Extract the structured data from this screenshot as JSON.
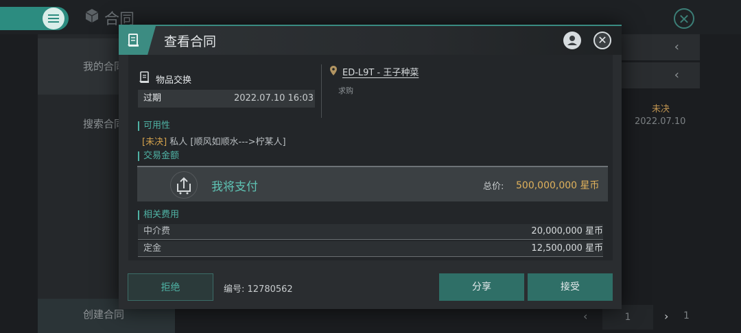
{
  "background": {
    "title": "合同",
    "sidebar": {
      "items": [
        "我的合同",
        "搜索合同"
      ],
      "bottom": "创建合同"
    },
    "list_status": "未决",
    "list_date": "2022.07.10",
    "pager": {
      "current": "1",
      "total": "1"
    }
  },
  "modal": {
    "title": "查看合同",
    "trade_type": "物品交换",
    "expire": {
      "label": "过期",
      "date": "2022.07.10 16:03"
    },
    "location": "ED-L9T - 王子种菜",
    "request": "求购",
    "availability": {
      "section": "可用性",
      "status": "[未决]",
      "text": "私人 [顺风如顺水--->柠某人]"
    },
    "amount": {
      "section": "交易金额",
      "pay_label": "我将支付",
      "total_label": "总价:",
      "total_value": "500,000,000 星币"
    },
    "fees": {
      "section": "相关费用",
      "rows": [
        {
          "label": "中介费",
          "value": "20,000,000 星币"
        },
        {
          "label": "定金",
          "value": "12,500,000 星币"
        }
      ]
    },
    "footer": {
      "reject": "拒绝",
      "contract_no": "编号: 12780562",
      "share": "分享",
      "accept": "接受"
    }
  },
  "colors": {
    "accent": "#3c8c82",
    "accent_text": "#4fb3a5",
    "gold": "#e1b25c",
    "pending": "#d4a24c"
  }
}
